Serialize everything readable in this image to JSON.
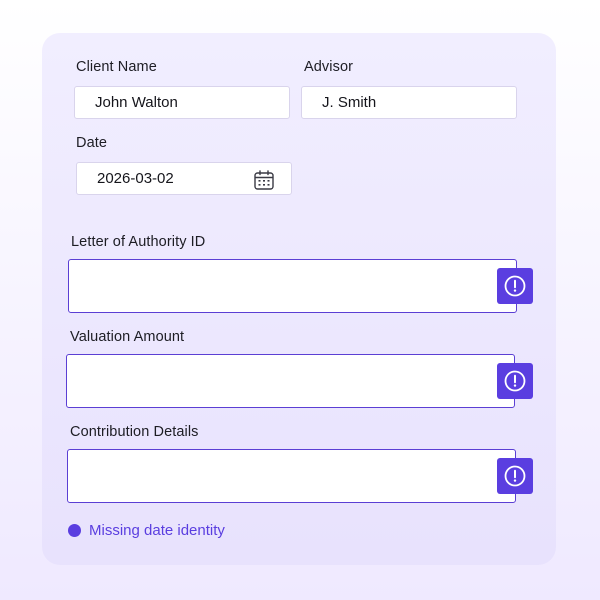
{
  "form": {
    "client_name": {
      "label": "Client Name",
      "value": "John Walton"
    },
    "advisor": {
      "label": "Advisor",
      "value": "J. Smith"
    },
    "date": {
      "label": "Date",
      "value": "2026-03-02",
      "icon": "calendar-icon"
    },
    "loa_id": {
      "label": "Letter of Authority ID",
      "value": "",
      "alert_icon": "alert-circle-icon"
    },
    "valuation_amount": {
      "label": "Valuation Amount",
      "value": "",
      "alert_icon": "alert-circle-icon"
    },
    "contribution_details": {
      "label": "Contribution Details",
      "value": "",
      "alert_icon": "alert-circle-icon"
    }
  },
  "status": {
    "text": "Missing date identity",
    "color": "#5a3ee0"
  },
  "colors": {
    "accent": "#5a3ee0",
    "field_border_error": "#5b3fd4"
  }
}
